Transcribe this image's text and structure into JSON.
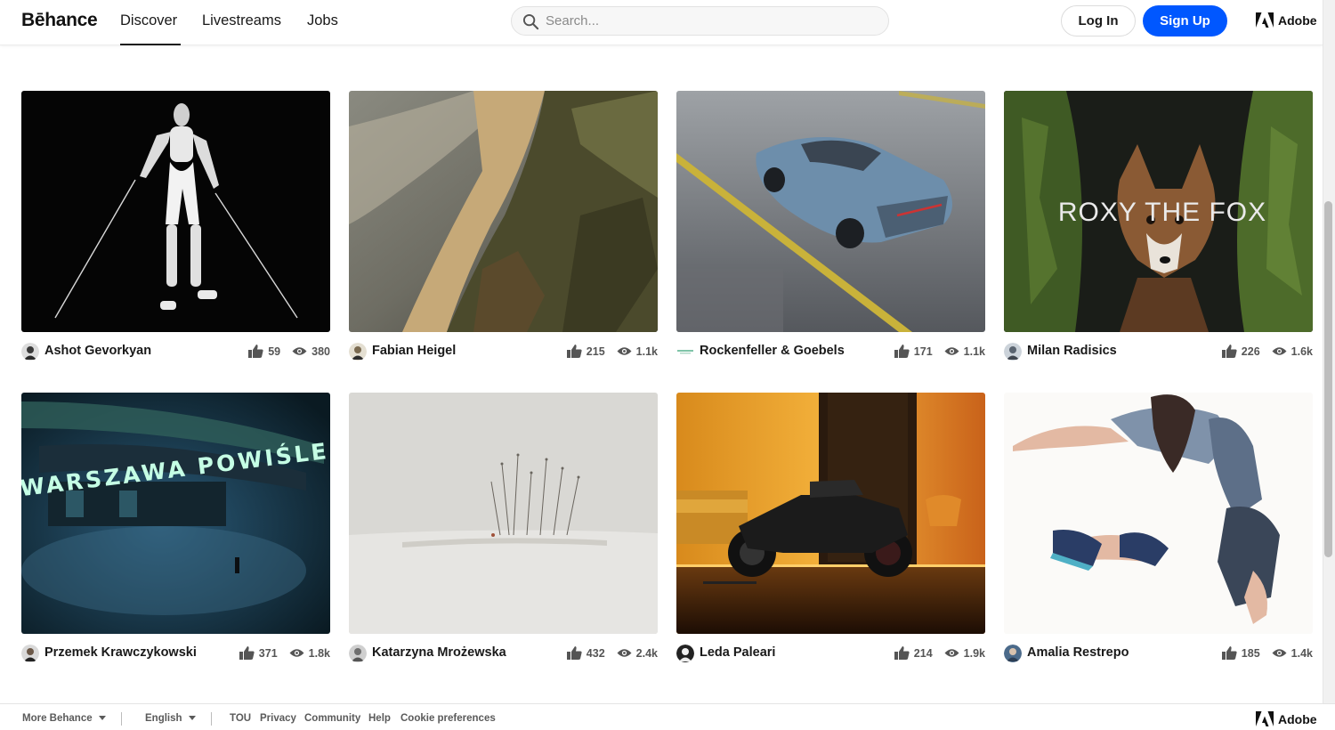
{
  "header": {
    "logo": "Bēhance",
    "nav": [
      "Discover",
      "Livestreams",
      "Jobs"
    ],
    "search_placeholder": "Search...",
    "login": "Log In",
    "signup": "Sign Up",
    "adobe": "Adobe"
  },
  "projects": [
    {
      "owner": "Ashot Gevorkyan",
      "likes": "59",
      "views": "380"
    },
    {
      "owner": "Fabian Heigel",
      "likes": "215",
      "views": "1.1k"
    },
    {
      "owner": "Rockenfeller & Goebels",
      "likes": "171",
      "views": "1.1k"
    },
    {
      "owner": "Milan Radisics",
      "likes": "226",
      "views": "1.6k",
      "overlay_text": "ROXY THE FOX"
    },
    {
      "owner": "Przemek Krawczykowski",
      "likes": "371",
      "views": "1.8k",
      "overlay_text": "WARSZAWA POWIŚLE"
    },
    {
      "owner": "Katarzyna Mrożewska",
      "likes": "432",
      "views": "2.4k"
    },
    {
      "owner": "Leda Paleari",
      "likes": "214",
      "views": "1.9k"
    },
    {
      "owner": "Amalia Restrepo",
      "likes": "185",
      "views": "1.4k"
    }
  ],
  "footer": {
    "more": "More Behance",
    "language": "English",
    "links": [
      "TOU",
      "Privacy",
      "Community",
      "Help",
      "Cookie preferences"
    ],
    "adobe": "Adobe"
  },
  "colors": {
    "accent": "#0057ff",
    "text": "#191919"
  },
  "icons": [
    "search-icon",
    "adobe-logo-icon",
    "like-icon",
    "view-icon",
    "caret-down-icon"
  ]
}
